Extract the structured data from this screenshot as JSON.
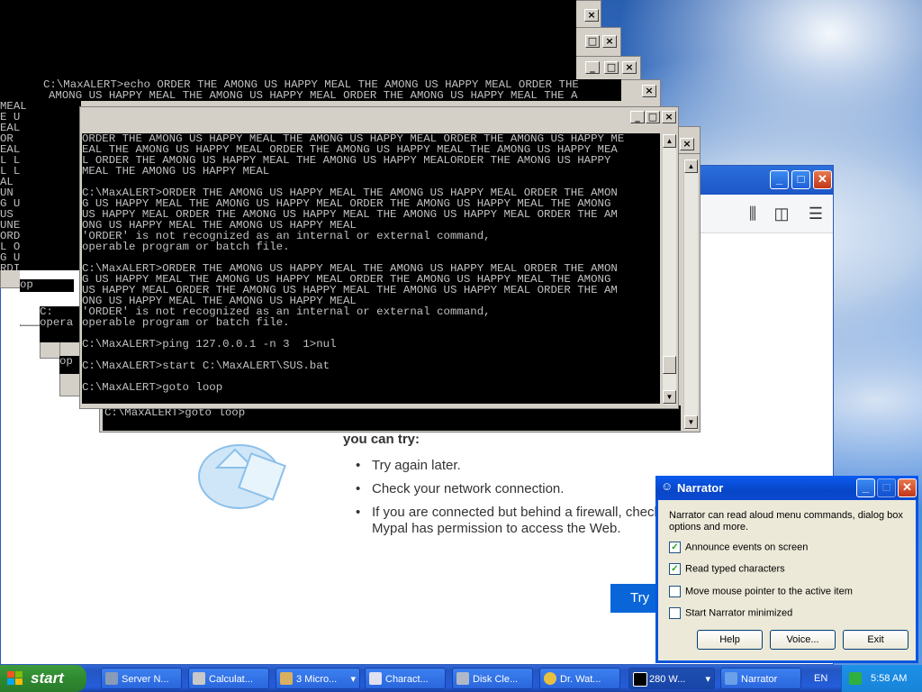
{
  "console_text": {
    "repeat_line": "EAL THE AMONG US HAPPY MEAL ORDER THE AMONG US HAPPY MEAL ORDER THE AMONG US HAPPY MEA",
    "c1_partial": "C:\\MaxALERT>echo ORDER THE AMONG US HAPPY MEAL THE AMONG US HAPPY MEAL ORDER THE",
    "c1_partial2": "AMONG US HAPPY MEAL THE AMONG US HAPPY MEAL ORDER THE AMONG US HAPPY MEAL THE A",
    "left_fragments": [
      "L AE",
      "MEAL",
      "E U",
      "EAL",
      "OR",
      "EAL",
      "L L",
      "L L",
      "AL",
      "UN",
      "G U",
      "US",
      "UNE",
      "ORD",
      "L O",
      "G U",
      "RDI",
      "ORD",
      "DIC",
      "ORD",
      "ORD",
      "US",
      "L O",
      "'ORI",
      "US",
      "DUS",
      "ORD",
      "'ORDI"
    ],
    "main_lines": [
      "ORDER THE AMONG US HAPPY MEAL THE AMONG US HAPPY MEAL ORDER THE AMONG US HAPPY ME",
      "EAL THE AMONG US HAPPY MEAL ORDER THE AMONG US HAPPY MEAL THE AMONG US HAPPY MEA",
      "L ORDER THE AMONG US HAPPY MEAL THE AMONG US HAPPY MEALORDER THE AMONG US HAPPY",
      "MEAL THE AMONG US HAPPY MEAL",
      "",
      "C:\\MaxALERT>ORDER THE AMONG US HAPPY MEAL THE AMONG US HAPPY MEAL ORDER THE AMON",
      "G US HAPPY MEAL THE AMONG US HAPPY MEAL ORDER THE AMONG US HAPPY MEAL THE AMONG",
      "US HAPPY MEAL ORDER THE AMONG US HAPPY MEAL THE AMONG US HAPPY MEAL ORDER THE AM",
      "ONG US HAPPY MEAL THE AMONG US HAPPY MEAL",
      "'ORDER' is not recognized as an internal or external command,",
      "operable program or batch file.",
      "",
      "C:\\MaxALERT>ORDER THE AMONG US HAPPY MEAL THE AMONG US HAPPY MEAL ORDER THE AMON",
      "G US HAPPY MEAL THE AMONG US HAPPY MEAL ORDER THE AMONG US HAPPY MEAL THE AMONG",
      "US HAPPY MEAL ORDER THE AMONG US HAPPY MEAL THE AMONG US HAPPY MEAL ORDER THE AM",
      "ONG US HAPPY MEAL THE AMONG US HAPPY MEAL",
      "'ORDER' is not recognized as an internal or external command,",
      "operable program or batch file.",
      "",
      "C:\\MaxALERT>ping 127.0.0.1 -n 3  1>nul",
      "",
      "C:\\MaxALERT>start C:\\MaxALERT\\SUS.bat",
      "",
      "C:\\MaxALERT>goto loop"
    ],
    "back_goto": "C:\\MaxALERT>goto loop",
    "op_fragment": "op",
    "opera_fragment": "opera",
    "c_fragment": "C:"
  },
  "browser": {
    "heading": "you can try:",
    "suggestions": [
      "Try again later.",
      "Check your network connection.",
      "If you are connected but behind a firewall, check"
    ],
    "suggestion_cont": "Mypal has permission to access the Web.",
    "try_button": "Try"
  },
  "narrator": {
    "title": "Narrator",
    "description": "Narrator can read aloud menu commands, dialog box options and more.",
    "options": [
      {
        "label": "Announce events on screen",
        "checked": true
      },
      {
        "label": "Read typed characters",
        "checked": true
      },
      {
        "label": "Move mouse pointer to the active item",
        "checked": false
      },
      {
        "label": "Start Narrator minimized",
        "checked": false
      }
    ],
    "buttons": {
      "help": "Help",
      "voice": "Voice...",
      "exit": "Exit"
    }
  },
  "taskbar": {
    "start_label": "start",
    "tasks": [
      {
        "label": "Server N..."
      },
      {
        "label": "Calculat..."
      },
      {
        "label": "3 Micro..."
      },
      {
        "label": "Charact..."
      },
      {
        "label": "Disk Cle..."
      },
      {
        "label": "Dr. Wat..."
      },
      {
        "label": "280 W..."
      },
      {
        "label": "Narrator"
      }
    ],
    "language": "EN",
    "clock": "5:58 AM"
  },
  "colors": {
    "xp_blue": "#0855dd",
    "start_green": "#2f8a2f",
    "console_bg": "#000000",
    "console_fg": "#c0c0c0",
    "try_button": "#0a66d8"
  }
}
